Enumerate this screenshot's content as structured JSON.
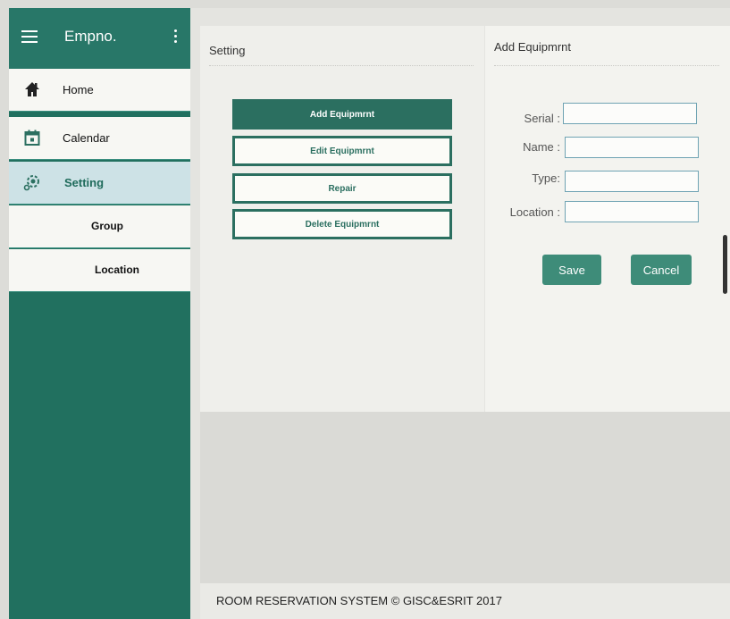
{
  "sidebar": {
    "app_title": "Empno.",
    "items": [
      {
        "label": "Home",
        "icon": "home-icon"
      },
      {
        "label": "Calendar",
        "icon": "calendar-icon"
      },
      {
        "label": "Setting",
        "icon": "setting-icon"
      },
      {
        "label": "Group"
      },
      {
        "label": "Location"
      }
    ]
  },
  "setting_panel": {
    "title": "Setting",
    "buttons": [
      {
        "label": "Add Equipmrnt"
      },
      {
        "label": "Edit Equipmrnt"
      },
      {
        "label": "Repair"
      },
      {
        "label": "Delete Equipmrnt"
      }
    ]
  },
  "form_panel": {
    "title": "Add Equipmrnt",
    "fields": [
      {
        "label": "Serial :",
        "value": ""
      },
      {
        "label": "Name :",
        "value": ""
      },
      {
        "label": "Type:",
        "value": ""
      },
      {
        "label": "Location :",
        "value": ""
      }
    ],
    "save_label": "Save",
    "cancel_label": "Cancel"
  },
  "footer": {
    "text": "ROOM RESERVATION SYSTEM © GISC&ESRIT 2017"
  },
  "colors": {
    "primary": "#2b6f60",
    "sidebar": "#21705f",
    "active_item": "#cde2e6",
    "button": "#3e8c79"
  }
}
